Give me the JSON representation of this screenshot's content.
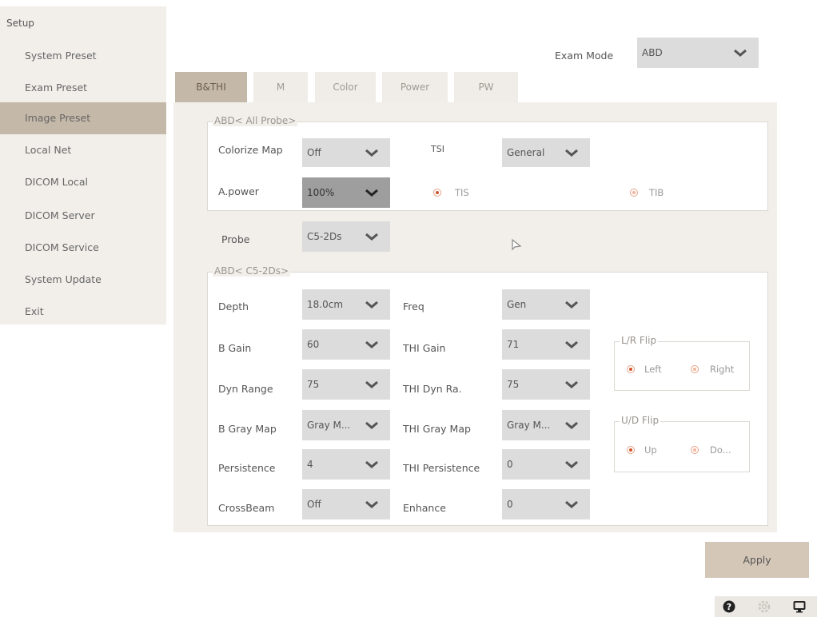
{
  "sidebar": {
    "title": "Setup",
    "items": [
      {
        "label": "System Preset",
        "active": false
      },
      {
        "label": "Exam Preset",
        "active": false
      },
      {
        "label": "Image Preset",
        "active": true
      },
      {
        "label": "Local Net",
        "active": false
      },
      {
        "label": "DICOM Local",
        "active": false
      },
      {
        "label": "DICOM Server",
        "active": false
      },
      {
        "label": "DICOM Service",
        "active": false
      },
      {
        "label": "System  Update",
        "active": false
      },
      {
        "label": "Exit",
        "active": false
      }
    ]
  },
  "exam_mode": {
    "label": "Exam Mode",
    "value": "ABD"
  },
  "tabs": [
    {
      "label": "B&THI",
      "active": true
    },
    {
      "label": "M",
      "active": false
    },
    {
      "label": "Color",
      "active": false
    },
    {
      "label": "Power",
      "active": false
    },
    {
      "label": "PW",
      "active": false
    }
  ],
  "all_probe": {
    "legend": "ABD< All Probe>",
    "colorize_map": {
      "label": "Colorize Map",
      "value": "Off"
    },
    "tsi": {
      "label": "TSI",
      "value": "General"
    },
    "apower": {
      "label": "A.power",
      "value": "100%"
    },
    "tis": {
      "label": "TIS",
      "selected": true
    },
    "tib": {
      "label": "TIB",
      "selected": false
    }
  },
  "probe": {
    "label": "Probe",
    "value": "C5-2Ds"
  },
  "probe_group": {
    "legend": "ABD< C5-2Ds>",
    "depth": {
      "label": "Depth",
      "value": "18.0cm"
    },
    "freq": {
      "label": "Freq",
      "value": "Gen"
    },
    "b_gain": {
      "label": "B Gain",
      "value": "60"
    },
    "thi_gain": {
      "label": "THI Gain",
      "value": "71"
    },
    "dyn_range": {
      "label": "Dyn Range",
      "value": "75"
    },
    "thi_dyn_ra": {
      "label": "THI Dyn Ra.",
      "value": "75"
    },
    "b_gray_map": {
      "label": "B Gray Map",
      "value": "Gray M..."
    },
    "thi_gray_map": {
      "label": "THI Gray Map",
      "value": "Gray M..."
    },
    "persistence": {
      "label": "Persistence",
      "value": "4"
    },
    "thi_persistence": {
      "label": "THI Persistence",
      "value": "0"
    },
    "crossbeam": {
      "label": "CrossBeam",
      "value": "Off"
    },
    "enhance": {
      "label": "Enhance",
      "value": "0"
    }
  },
  "lr_flip": {
    "legend": "L/R Flip",
    "left": "Left",
    "right": "Right",
    "selected": "left"
  },
  "ud_flip": {
    "legend": "U/D Flip",
    "up": "Up",
    "down": "Do...",
    "selected": "up"
  },
  "apply_label": "Apply",
  "status_icons": [
    "help-icon",
    "settings-icon",
    "monitor-icon"
  ]
}
